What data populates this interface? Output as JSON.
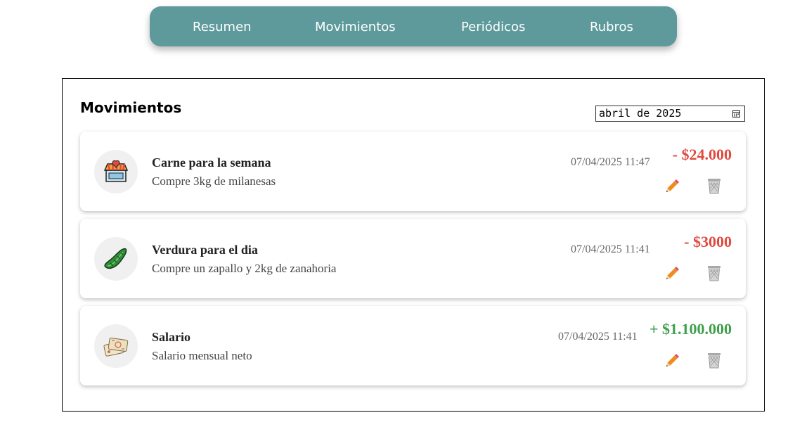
{
  "nav": {
    "items": [
      {
        "label": "Resumen",
        "icon": ""
      },
      {
        "label": "Movimientos",
        "icon": ""
      },
      {
        "label": "Periódicos",
        "icon": ""
      },
      {
        "label": "Rubros",
        "icon": ""
      }
    ]
  },
  "main": {
    "title": "Movimientos",
    "month_value": "abril de 2025",
    "month_icon": "calendar-icon"
  },
  "movements": [
    {
      "title": "Carne para la semana",
      "description": "Compre 3kg de milanesas",
      "datetime": "07/04/2025 11:47",
      "amount": "- $24.000",
      "type": "expense",
      "icon": "butcher-shop-icon"
    },
    {
      "title": "Verdura para el dia",
      "description": "Compre un zapallo y 2kg de zanahoria",
      "datetime": "07/04/2025 11:41",
      "amount": "- $3000",
      "type": "expense",
      "icon": "zucchini-icon"
    },
    {
      "title": "Salario",
      "description": "Salario mensual neto",
      "datetime": "07/04/2025 11:41",
      "amount": "+ $1.100.000",
      "type": "income",
      "icon": "money-icon"
    }
  ],
  "colors": {
    "nav_bg": "#5e9a9c",
    "expense": "#e04a3f",
    "income": "#3f9f4a",
    "edit_icon": "#f08c1e",
    "trash_icon": "#a9a9a9"
  }
}
